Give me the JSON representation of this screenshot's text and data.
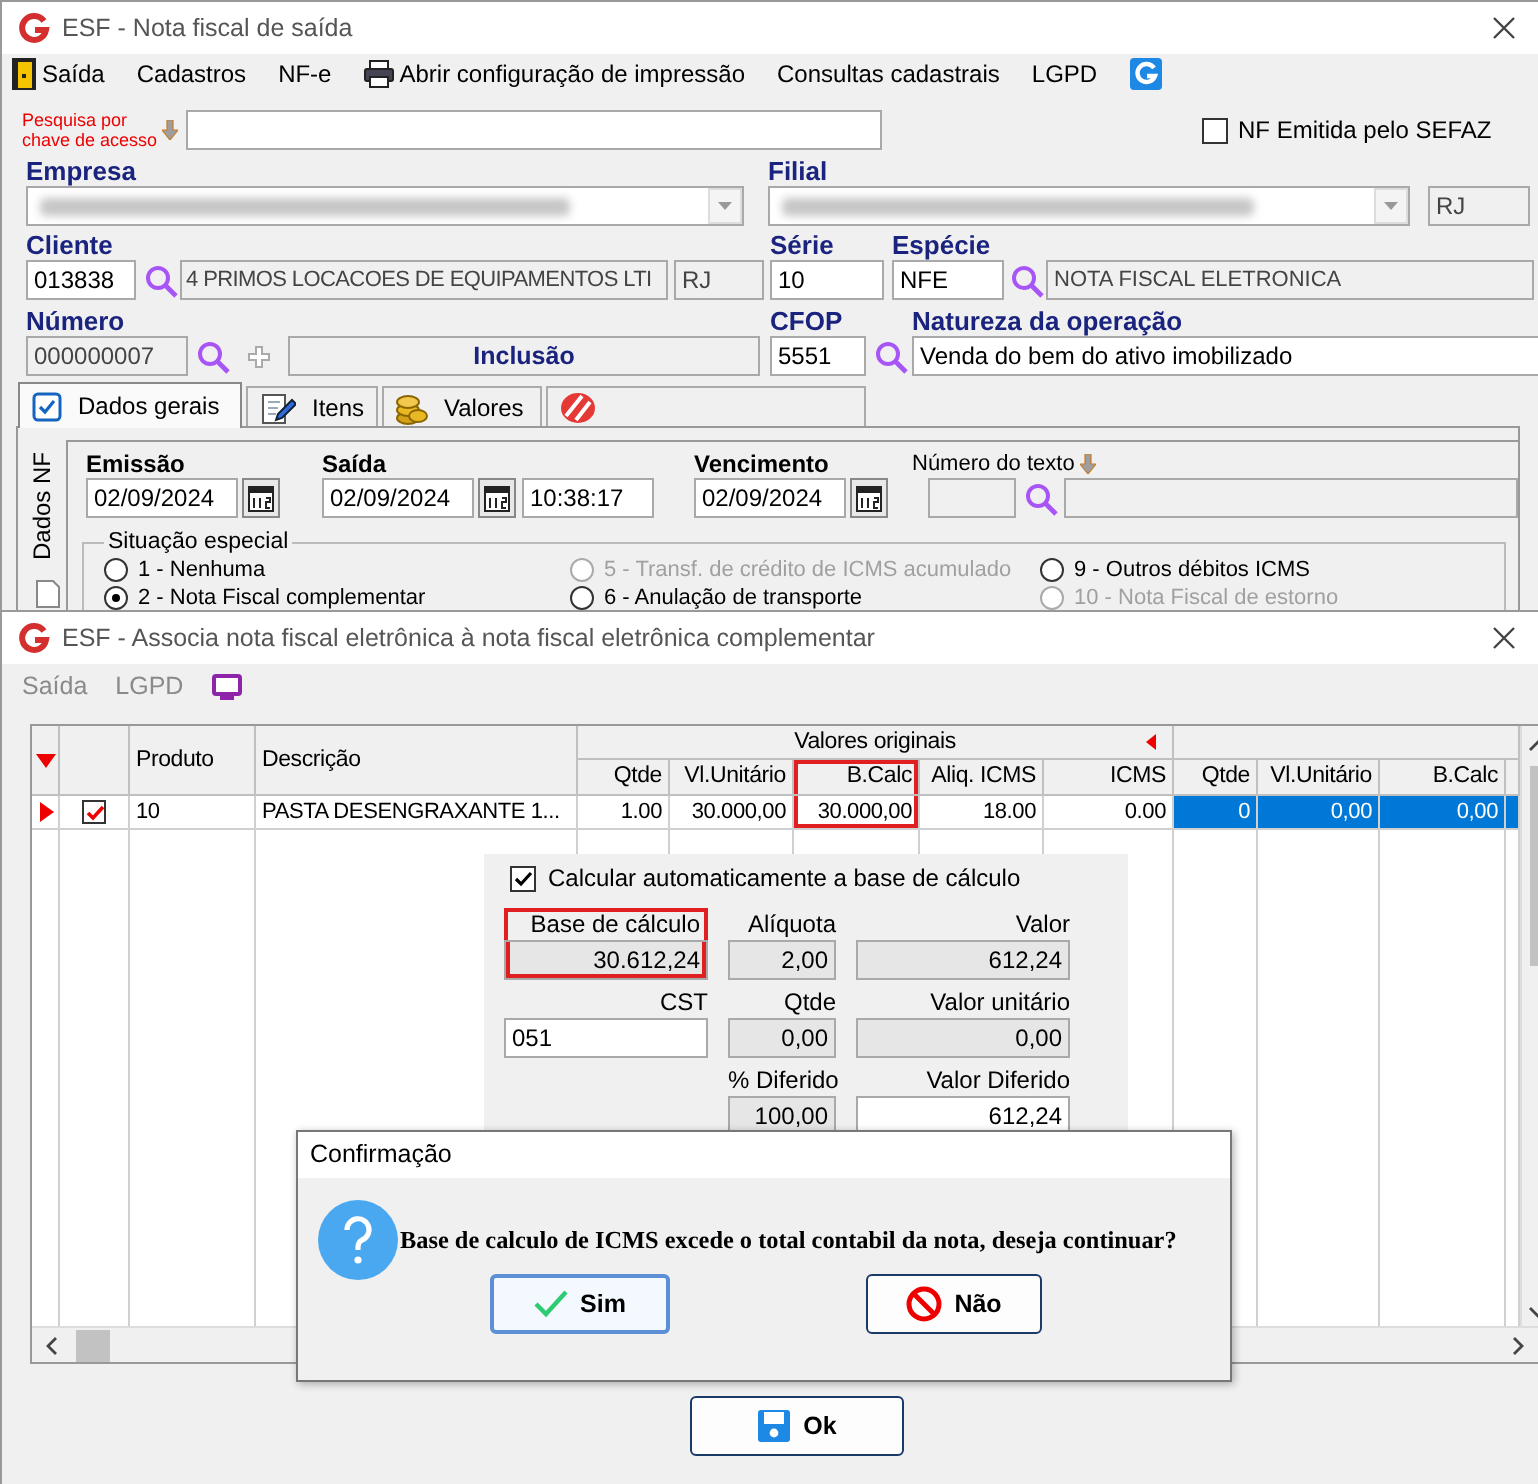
{
  "main_window": {
    "title": "ESF - Nota fiscal de saída",
    "menu": [
      {
        "label": "Saída",
        "kind": "exit"
      },
      {
        "label": "Cadastros",
        "kind": "text"
      },
      {
        "label": "NF-e",
        "kind": "text"
      },
      {
        "label": "Abrir configuração de impressão",
        "kind": "print"
      },
      {
        "label": "Consultas cadastrais",
        "kind": "text"
      },
      {
        "label": "LGPD",
        "kind": "text"
      }
    ],
    "access_key_search": {
      "label": "Pesquisa por chave de acesso"
    },
    "nf_emitida_sefaz": {
      "label": "NF Emitida pelo SEFAZ",
      "checked": false
    },
    "empresa": {
      "label": "Empresa"
    },
    "filial": {
      "label": "Filial",
      "uf": "RJ"
    },
    "cliente": {
      "label": "Cliente",
      "code": "013838",
      "name": "4 PRIMOS LOCACOES DE EQUIPAMENTOS LTI",
      "uf": "RJ"
    },
    "serie": {
      "label": "Série",
      "value": "10"
    },
    "especie": {
      "label": "Espécie",
      "code": "NFE",
      "description": "NOTA FISCAL ELETRONICA"
    },
    "numero": {
      "label": "Número",
      "value": "000000007",
      "status": "Inclusão"
    },
    "cfop": {
      "label": "CFOP",
      "value": "5551"
    },
    "natureza": {
      "label": "Natureza da operação",
      "value": "Venda do bem do ativo imobilizado"
    },
    "tabs": [
      {
        "label": "Dados gerais",
        "kind": "check",
        "selected": true
      },
      {
        "label": "Itens",
        "kind": "pen",
        "selected": false
      },
      {
        "label": "Valores",
        "kind": "coins",
        "selected": false
      },
      {
        "kind": "stripes",
        "selected": false
      }
    ],
    "side_tab": {
      "label": "Dados NF"
    },
    "emissao": {
      "label": "Emissão",
      "value": "02/09/2024"
    },
    "saida": {
      "label": "Saída",
      "value": "02/09/2024",
      "time": "10:38:17"
    },
    "vencimento": {
      "label": "Vencimento",
      "value": "02/09/2024"
    },
    "numero_texto": {
      "label": "Número do texto"
    },
    "situacao_especial": {
      "label": "Situação especial",
      "options": [
        {
          "label": "1 - Nenhuma",
          "selected": false,
          "disabled": false
        },
        {
          "label": "5 - Transf. de crédito de ICMS acumulado",
          "selected": false,
          "disabled": true
        },
        {
          "label": "9 - Outros débitos ICMS",
          "selected": false,
          "disabled": false
        },
        {
          "label": "2 - Nota Fiscal complementar",
          "selected": true,
          "disabled": false
        },
        {
          "label": "6 - Anulação de transporte",
          "selected": false,
          "disabled": false
        },
        {
          "label": "10 - Nota Fiscal de estorno",
          "selected": false,
          "disabled": true
        }
      ]
    }
  },
  "assoc_window": {
    "title": "ESF - Associa nota fiscal eletrônica à nota fiscal eletrônica complementar",
    "menu": [
      {
        "label": "Saída",
        "disabled": true
      },
      {
        "label": "LGPD",
        "disabled": true
      }
    ],
    "group_header": "Valores originais",
    "columns": [
      {
        "label": "Produto",
        "kind": "id",
        "highlighted": false
      },
      {
        "label": "Descrição",
        "kind": "id",
        "highlighted": false
      },
      {
        "label": "Qtde",
        "kind": "original",
        "highlighted": false
      },
      {
        "label": "Vl.Unitário",
        "kind": "original",
        "highlighted": false
      },
      {
        "label": "B.Calc",
        "kind": "original",
        "highlighted": true
      },
      {
        "label": "Aliq. ICMS",
        "kind": "original",
        "highlighted": false
      },
      {
        "label": "ICMS",
        "kind": "original",
        "highlighted": false
      },
      {
        "label": "Qtde",
        "kind": "current",
        "highlighted": false
      },
      {
        "label": "Vl.Unitário",
        "kind": "current",
        "highlighted": false
      },
      {
        "label": "B.Calc",
        "kind": "current",
        "highlighted": false
      }
    ],
    "rows": [
      {
        "selected": true,
        "checked": true,
        "cells": [
          "10",
          "PASTA DESENGRAXANTE 1...",
          "1.00",
          "30.000,00",
          "30.000,00",
          "18.00",
          "0.00",
          "0",
          "0,00",
          "0,00"
        ]
      }
    ],
    "auto_calc": {
      "label": "Calcular automaticamente a base de cálculo",
      "checked": true
    },
    "fields": [
      [
        {
          "label": "Base de cálculo",
          "value": "30.612,24",
          "editable": false,
          "highlighted": true
        },
        {
          "label": "Alíquota",
          "value": "2,00",
          "editable": false,
          "highlighted": false
        },
        {
          "label": "Valor",
          "value": "612,24",
          "editable": false,
          "highlighted": false
        }
      ],
      [
        {
          "label": "CST",
          "value": "051",
          "editable": true,
          "highlighted": false
        },
        {
          "label": "Qtde",
          "value": "0,00",
          "editable": false,
          "highlighted": false
        },
        {
          "label": "Valor unitário",
          "value": "0,00",
          "editable": false,
          "highlighted": false
        }
      ],
      [
        {
          "label": "% Diferido",
          "value": "100,00",
          "editable": false,
          "highlighted": false
        },
        {
          "label": "Valor Diferido",
          "value": "612,24",
          "editable": true,
          "highlighted": false
        }
      ]
    ],
    "ok_button": {
      "label": "Ok"
    }
  },
  "confirm_dialog": {
    "title": "Confirmação",
    "message": "Base de calculo de ICMS excede o total contabil da nota, deseja continuar?",
    "buttons": [
      {
        "label": "Sim",
        "kind": "ok",
        "focused": true
      },
      {
        "label": "Não",
        "kind": "cancel",
        "focused": false
      }
    ]
  }
}
